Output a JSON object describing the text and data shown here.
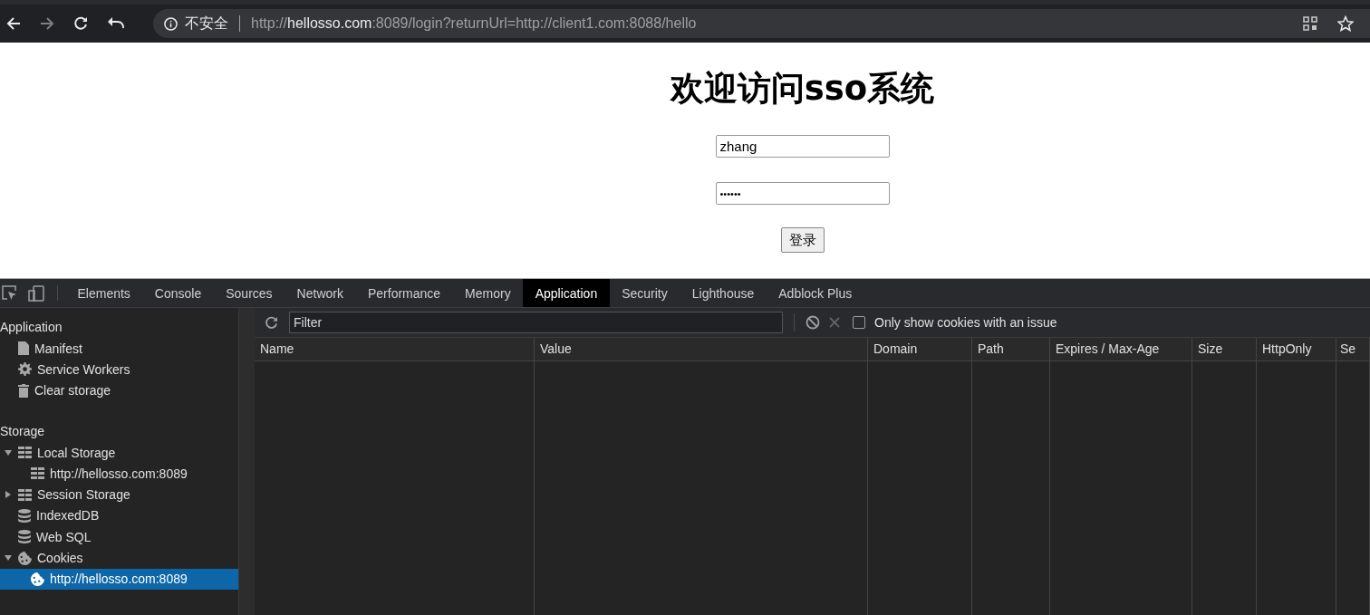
{
  "browser": {
    "security_label": "不安全",
    "url": {
      "scheme": "http://",
      "host": "hellosso.com",
      "rest": ":8089/login?returnUrl=http://client1.com:8088/hello"
    }
  },
  "page": {
    "heading": "欢迎访问sso系统",
    "username": "zhang",
    "password_mask": "••••••",
    "login_button": "登录"
  },
  "devtools": {
    "tabs": [
      {
        "label": "Elements",
        "selected": false
      },
      {
        "label": "Console",
        "selected": false
      },
      {
        "label": "Sources",
        "selected": false
      },
      {
        "label": "Network",
        "selected": false
      },
      {
        "label": "Performance",
        "selected": false
      },
      {
        "label": "Memory",
        "selected": false
      },
      {
        "label": "Application",
        "selected": true
      },
      {
        "label": "Security",
        "selected": false
      },
      {
        "label": "Lighthouse",
        "selected": false
      },
      {
        "label": "Adblock Plus",
        "selected": false
      }
    ],
    "sidebar": [
      {
        "heading": "Application",
        "items": [
          {
            "label": "Manifest",
            "kind": "file",
            "selected": false
          },
          {
            "label": "Service Workers",
            "kind": "gear",
            "selected": false
          },
          {
            "label": "Clear storage",
            "kind": "trash",
            "selected": false
          }
        ]
      },
      {
        "heading": "Storage",
        "items": [
          {
            "label": "Local Storage",
            "kind": "grid",
            "expanded": true,
            "selected": false,
            "children": [
              {
                "label": "http://hellosso.com:8089",
                "kind": "grid",
                "selected": false
              }
            ]
          },
          {
            "label": "Session Storage",
            "kind": "grid",
            "expanded": false,
            "selected": false
          },
          {
            "label": "IndexedDB",
            "kind": "database",
            "selected": false
          },
          {
            "label": "Web SQL",
            "kind": "database",
            "selected": false
          },
          {
            "label": "Cookies",
            "kind": "cookie",
            "expanded": true,
            "selected": false,
            "children": [
              {
                "label": "http://hellosso.com:8089",
                "kind": "cookie",
                "selected": true
              }
            ]
          }
        ]
      }
    ],
    "filter": {
      "placeholder": "Filter"
    },
    "issue_checkbox": {
      "label": "Only show cookies with an issue",
      "checked": false
    },
    "table": {
      "columns": [
        "Name",
        "Value",
        "Domain",
        "Path",
        "Expires / Max-Age",
        "Size",
        "HttpOnly",
        "Se"
      ]
    }
  }
}
